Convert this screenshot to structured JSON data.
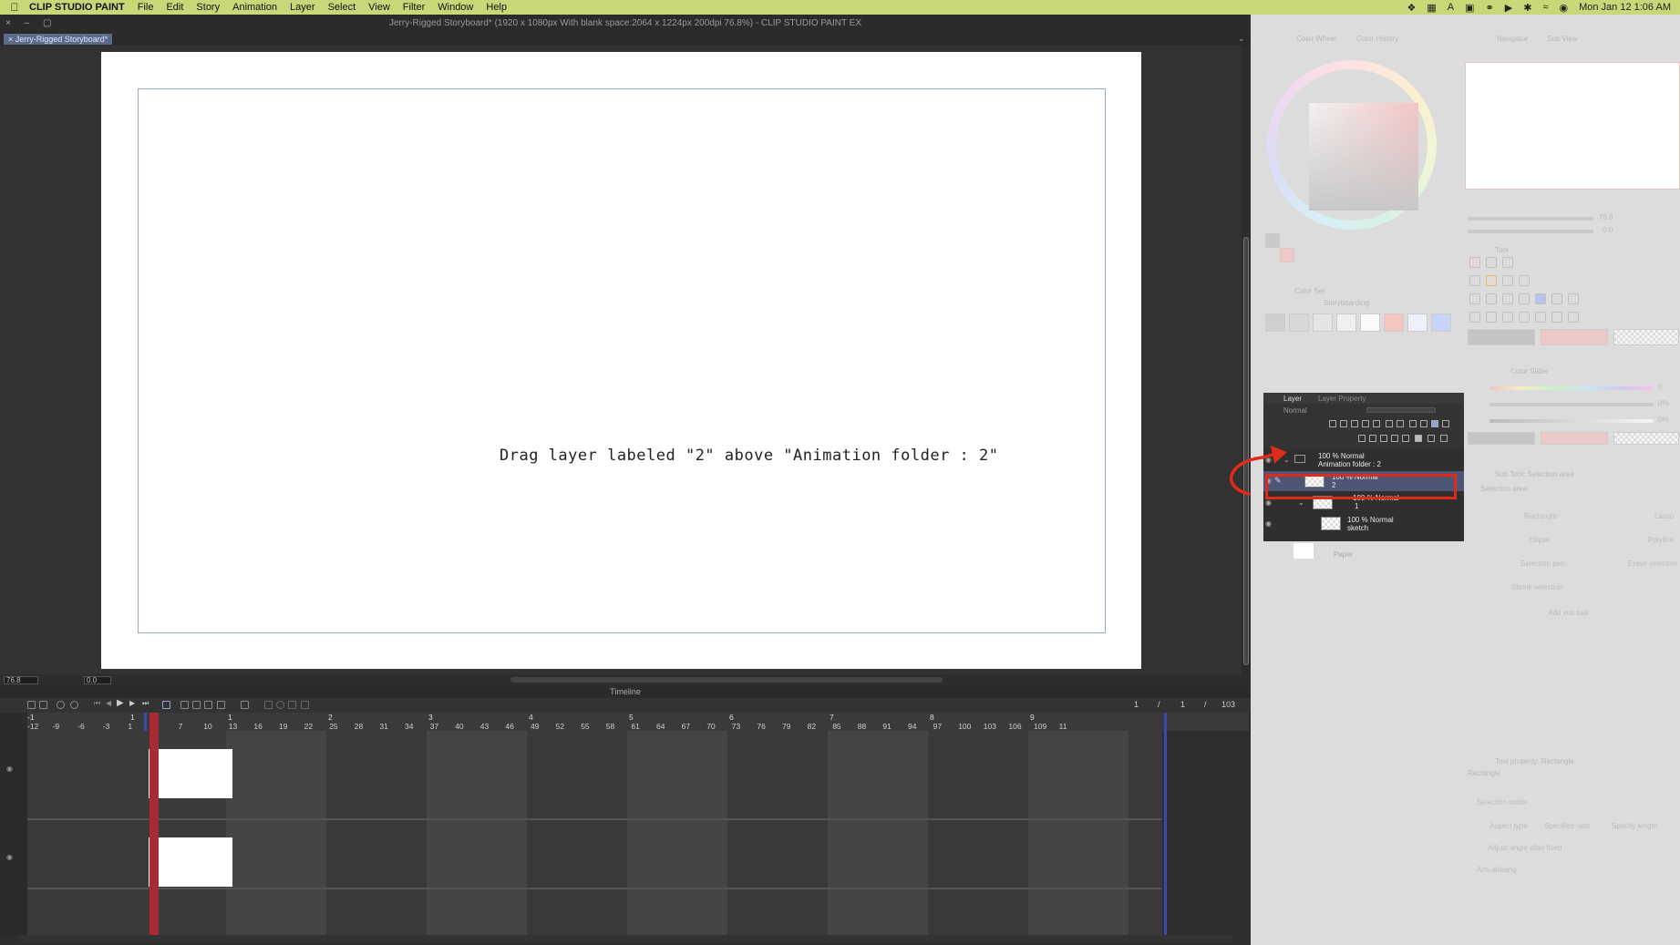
{
  "menubar": {
    "app_name": "CLIP STUDIO PAINT",
    "items": [
      "File",
      "Edit",
      "Story",
      "Animation",
      "Layer",
      "Select",
      "View",
      "Filter",
      "Window",
      "Help"
    ],
    "clock": "Mon Jan 12  1:06 AM"
  },
  "window": {
    "title": "Jerry-Rigged Storyboard* (1920 x 1080px With blank space:2064 x 1224px 200dpi 76.8%)  - CLIP STUDIO PAINT EX",
    "tab_label": "× Jerry-Rigged Storyboard*"
  },
  "canvas": {
    "instruction": "Drag layer labeled \"2\" above \"Animation folder : 2\"",
    "zoom_value": "76.8",
    "rotation_value": "0.0"
  },
  "timeline": {
    "title": "Timeline",
    "counter": {
      "current": "1",
      "sep1": "/",
      "frame": "1",
      "sep2": "/",
      "total": "103"
    },
    "frame_numbers": [
      "-12",
      "-9",
      "-6",
      "-3",
      "1",
      "4",
      "7",
      "10",
      "13",
      "16",
      "19",
      "22",
      "25",
      "28",
      "31",
      "34",
      "37",
      "40",
      "43",
      "46",
      "49",
      "52",
      "55",
      "58",
      "61",
      "64",
      "67",
      "70",
      "73",
      "76",
      "79",
      "82",
      "85",
      "88",
      "91",
      "94",
      "97",
      "100",
      "103",
      "106",
      "109",
      "11"
    ],
    "second_marks": [
      "-1",
      "1",
      "1",
      "2",
      "3",
      "4",
      "5",
      "6",
      "7",
      "8",
      "9"
    ],
    "cel_label_1": "1"
  },
  "panels": {
    "color_wheel": "Color Wheel",
    "color_history": "Color History",
    "navigator": "Navigator",
    "sub_view": "Sub View",
    "color_set": "Color Set",
    "color_set_name": "Storyboarding",
    "tool": "Tool",
    "color_slider": "Color Slider",
    "sub_tool": "Sub Tool: Selection area",
    "selection_area": "Selection area",
    "sub_tool_items": [
      "Rectangle",
      "Lasso",
      "Ellipse",
      "Polyline",
      "Selection pen",
      "Erase selection",
      "Shrink selection"
    ],
    "add_sub_tool": "Add sub tool",
    "tool_property": "Tool property: Rectangle",
    "tool_property_name": "Rectangle",
    "props": [
      "Selection mode",
      "Aspect type",
      "Specified ratio",
      "Specify length",
      "Adjust angle after fixed",
      "Anti-aliasing"
    ],
    "navigator_zoom": "76.8",
    "navigator_rotate": "0.0",
    "slider_values": [
      "0",
      "0%",
      "0%"
    ]
  },
  "layer_panel": {
    "tabs": [
      "Layer",
      "Layer Property"
    ],
    "blend_mode": "Normal",
    "layers": [
      {
        "line1": "100 % Normal",
        "line2": "Animation folder : 2"
      },
      {
        "line1": "100 % Normal",
        "line2": "2"
      },
      {
        "line1": "100 % Normal",
        "line2": "1"
      },
      {
        "line1": "100 % Normal",
        "line2": "sketch"
      }
    ],
    "paper": "Paper"
  },
  "colors": {
    "menubar_bg": "#c7d878",
    "selected_layer": "#4d5675",
    "highlight_red": "#e02a1c",
    "playhead_red": "#a82a32"
  }
}
